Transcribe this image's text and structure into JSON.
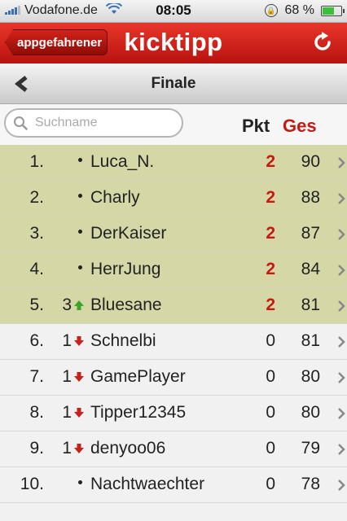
{
  "status_bar": {
    "carrier": "Vodafone.de",
    "time": "08:05",
    "battery": "68 %",
    "battery_level": 0.68
  },
  "header": {
    "back_label": "appgefahrener",
    "brand": "kicktipp",
    "accent": "#d42218"
  },
  "subheader": {
    "title": "Finale"
  },
  "search": {
    "placeholder": "Suchname",
    "value": ""
  },
  "columns": {
    "pkt": "Pkt",
    "ges": "Ges"
  },
  "rows": [
    {
      "rank": "1.",
      "move": "",
      "dir": "none",
      "name": "Luca_N.",
      "pkt": "2",
      "ges": "90",
      "top": true
    },
    {
      "rank": "2.",
      "move": "",
      "dir": "none",
      "name": "Charly",
      "pkt": "2",
      "ges": "88",
      "top": true
    },
    {
      "rank": "3.",
      "move": "",
      "dir": "none",
      "name": "DerKaiser",
      "pkt": "2",
      "ges": "87",
      "top": true
    },
    {
      "rank": "4.",
      "move": "",
      "dir": "none",
      "name": "HerrJung",
      "pkt": "2",
      "ges": "84",
      "top": true
    },
    {
      "rank": "5.",
      "move": "3",
      "dir": "up",
      "name": "Bluesane",
      "pkt": "2",
      "ges": "81",
      "top": true
    },
    {
      "rank": "6.",
      "move": "1",
      "dir": "down",
      "name": "Schnelbi",
      "pkt": "0",
      "ges": "81",
      "top": false
    },
    {
      "rank": "7.",
      "move": "1",
      "dir": "down",
      "name": "GamePlayer",
      "pkt": "0",
      "ges": "80",
      "top": false
    },
    {
      "rank": "8.",
      "move": "1",
      "dir": "down",
      "name": "Tipper12345",
      "pkt": "0",
      "ges": "80",
      "top": false
    },
    {
      "rank": "9.",
      "move": "1",
      "dir": "down",
      "name": "denyoo06",
      "pkt": "0",
      "ges": "79",
      "top": false
    },
    {
      "rank": "10.",
      "move": "",
      "dir": "none",
      "name": "Nachtwaechter",
      "pkt": "0",
      "ges": "78",
      "top": false
    }
  ]
}
